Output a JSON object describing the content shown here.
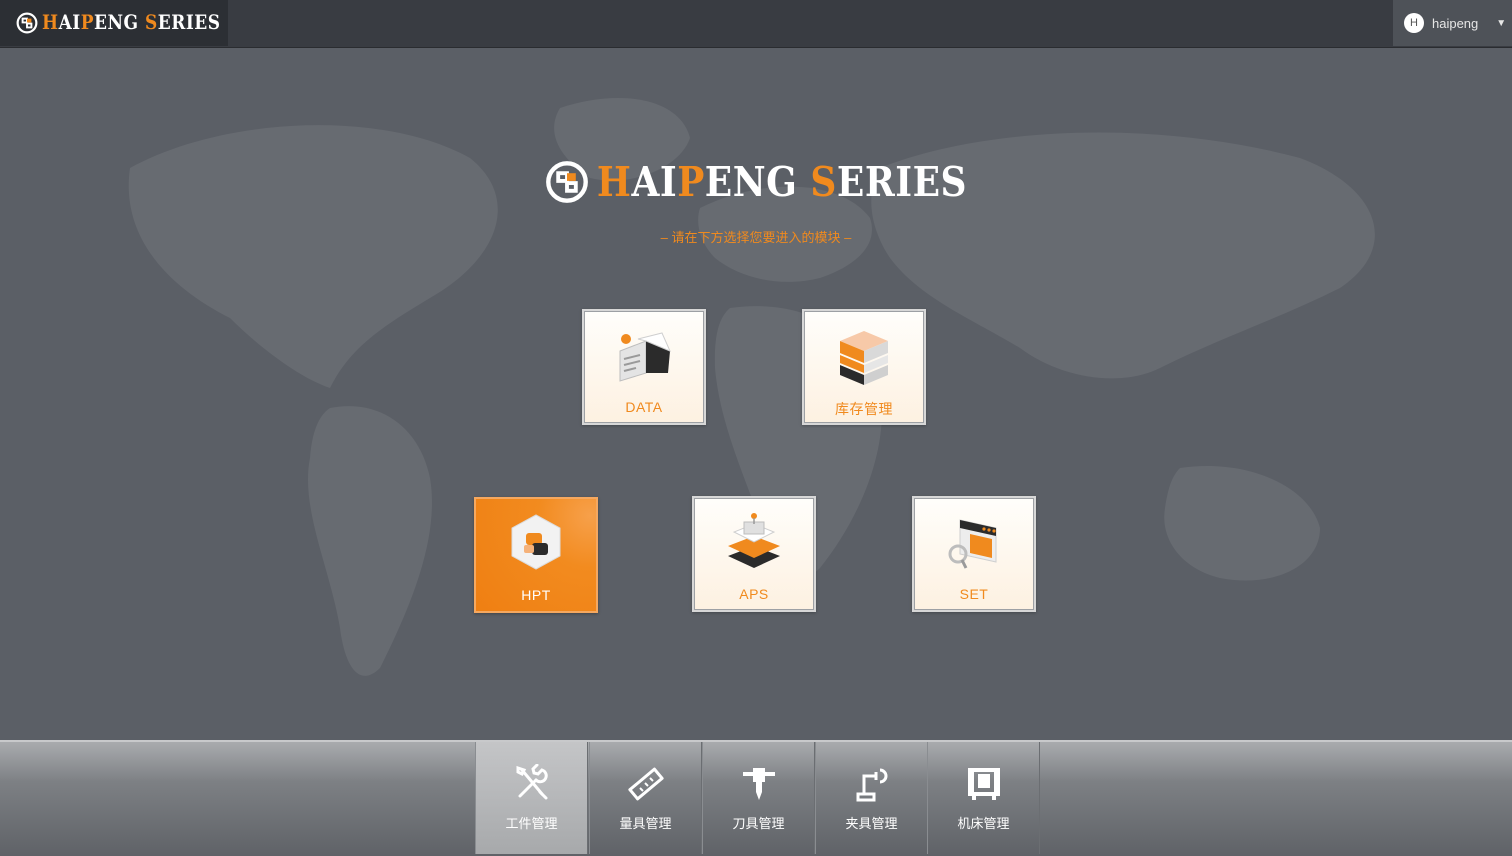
{
  "header": {
    "brand_part1": "H",
    "brand_part2": "AI",
    "brand_part3": "P",
    "brand_part4": "ENG ",
    "brand_part5": "S",
    "brand_part6": "ERIES",
    "user_initial": "H",
    "username": "haipeng",
    "caret": "▼"
  },
  "hero": {
    "brand_part1": "H",
    "brand_part2": "AI",
    "brand_part3": "P",
    "brand_part4": "ENG ",
    "brand_part5": "S",
    "brand_part6": "ERIES",
    "subtitle": "– 请在下方选择您要进入的模块 –"
  },
  "modules": [
    {
      "label": "DATA",
      "icon": "data-server-icon"
    },
    {
      "label": "库存管理",
      "icon": "inventory-stack-icon"
    },
    {
      "label": "HPT",
      "icon": "hpt-hexagon-icon",
      "active": true
    },
    {
      "label": "APS",
      "icon": "aps-layers-icon"
    },
    {
      "label": "SET",
      "icon": "settings-search-icon"
    }
  ],
  "bottom_nav": [
    {
      "label": "工件管理",
      "icon": "wrench-screwdriver-icon",
      "active": true
    },
    {
      "label": "量具管理",
      "icon": "ruler-icon"
    },
    {
      "label": "刀具管理",
      "icon": "cutting-tool-icon"
    },
    {
      "label": "夹具管理",
      "icon": "fixture-arm-icon"
    },
    {
      "label": "机床管理",
      "icon": "machine-tool-icon"
    }
  ],
  "colors": {
    "accent": "#f08a1e",
    "topbar": "#393c42",
    "background": "#5d6168"
  }
}
